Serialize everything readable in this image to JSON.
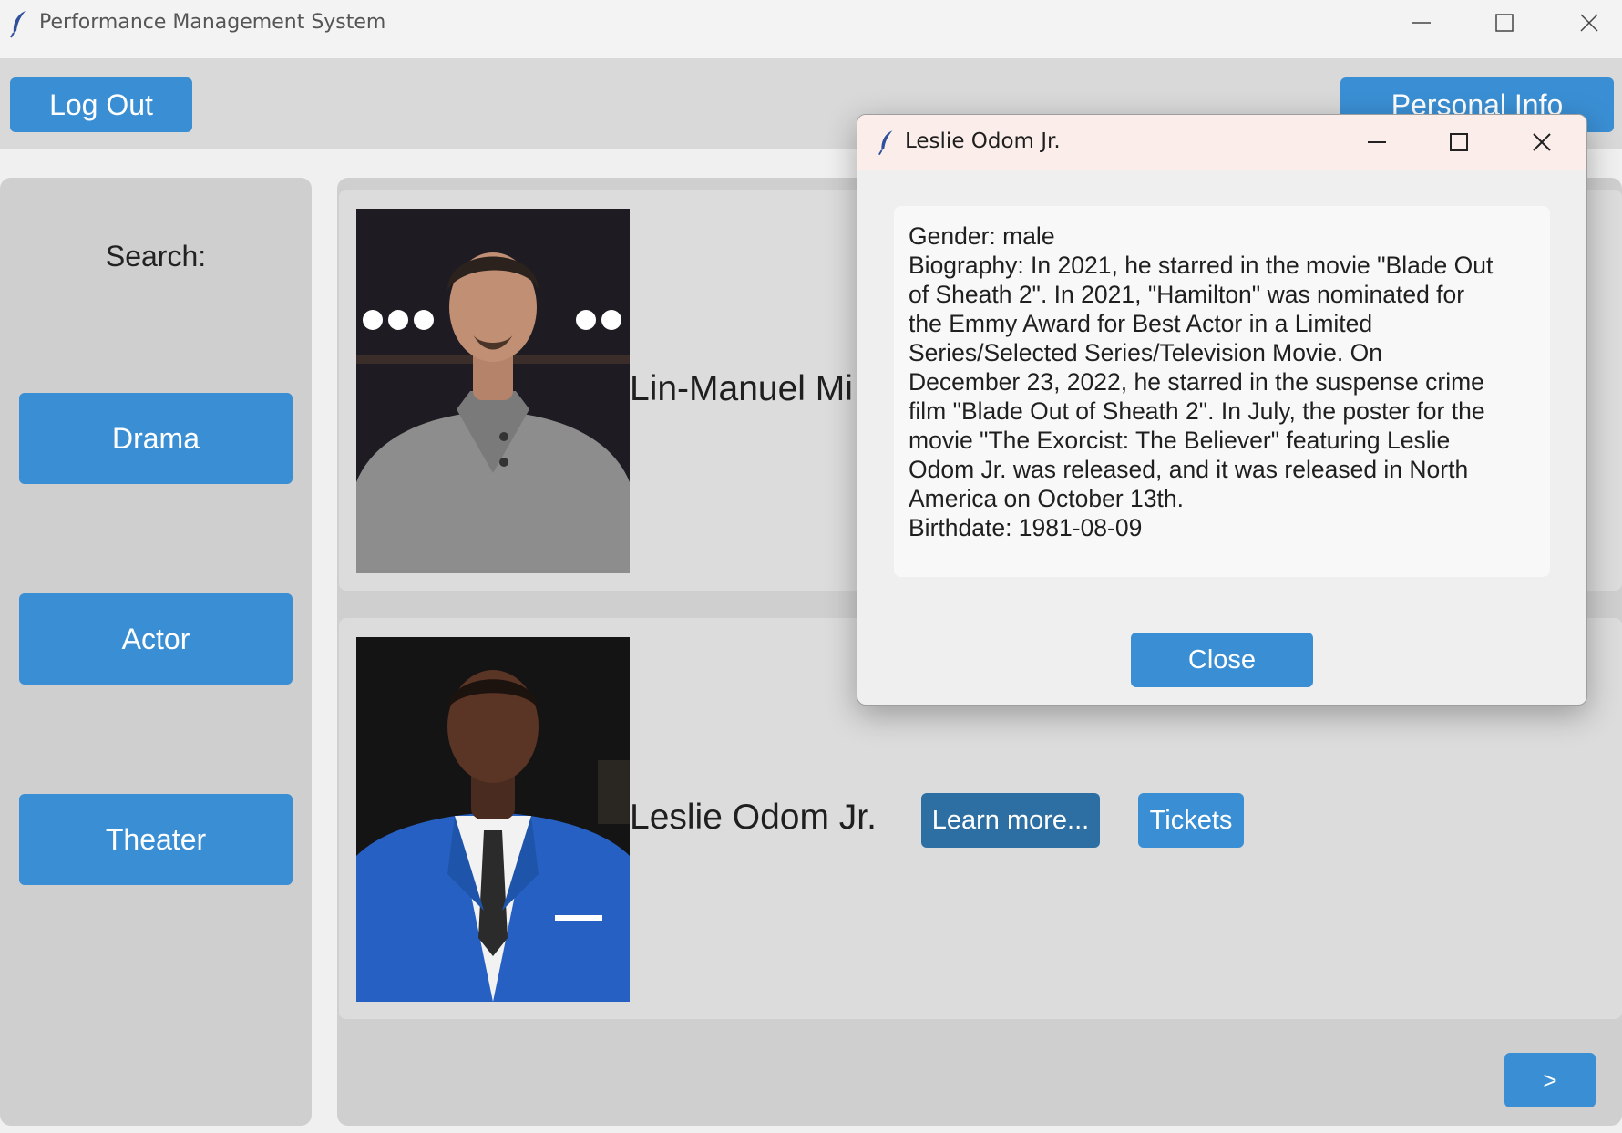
{
  "window": {
    "title": "Performance Management System"
  },
  "header": {
    "logout_label": "Log Out",
    "personal_info_label": "Personal Info"
  },
  "sidebar": {
    "search_label": "Search:",
    "items": [
      {
        "label": "Drama"
      },
      {
        "label": "Actor"
      },
      {
        "label": "Theater"
      }
    ]
  },
  "cards": [
    {
      "name": "Lin-Manuel Mi"
    },
    {
      "name": "Leslie Odom Jr.",
      "learn_more_label": "Learn more...",
      "tickets_label": "Tickets"
    }
  ],
  "pagination": {
    "next_label": ">"
  },
  "dialog": {
    "title": "Leslie Odom Jr.",
    "gender": "Gender: male",
    "biography_lines": [
      "Biography: In 2021, he starred in the movie \"Blade Out",
      "of Sheath 2\". In 2021, \"Hamilton\" was nominated for",
      "the Emmy Award for Best Actor in a Limited",
      "Series/Selected Series/Television Movie. On",
      "December 23, 2022, he starred in the suspense crime",
      "film \"Blade Out of Sheath 2\". In July, the poster for the",
      "movie \"The Exorcist: The Believer\" featuring Leslie",
      "Odom Jr. was released, and it was released in North",
      "America on October 13th."
    ],
    "birthdate": "Birthdate: 1981-08-09",
    "close_label": "Close"
  },
  "icons": {
    "app": "feather-icon",
    "minimize": "minimize-icon",
    "maximize": "maximize-icon",
    "close": "close-icon"
  },
  "colors": {
    "accent_button": "#3a8fd4",
    "active_button": "#2e6fa3",
    "panel": "#cfcfcf",
    "card": "#dcdcdc",
    "dialog_titlebar": "#fbeeea"
  }
}
